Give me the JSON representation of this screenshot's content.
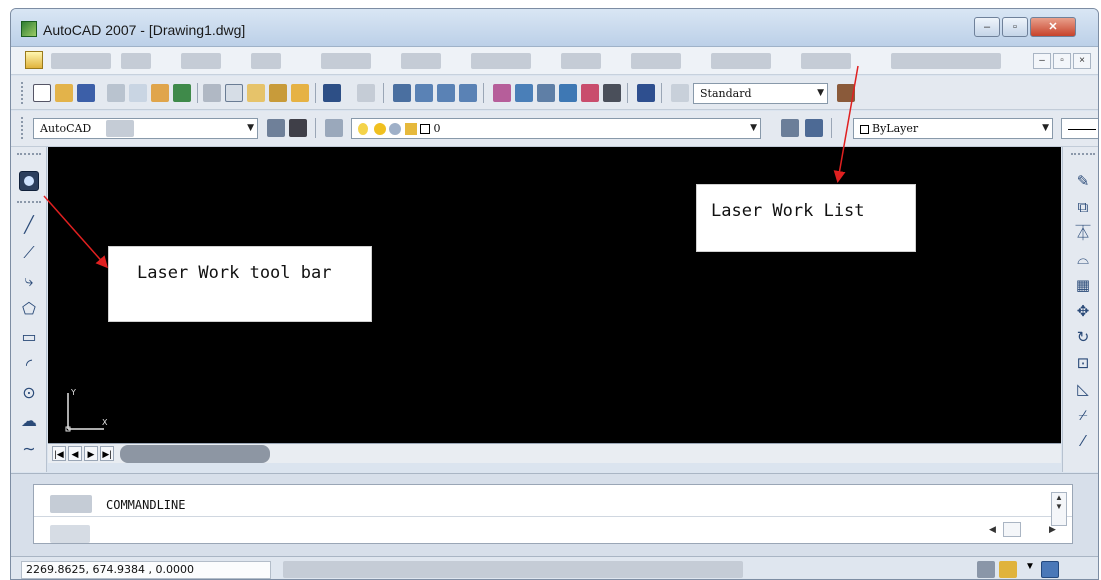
{
  "window": {
    "title": "AutoCAD 2007 - [Drawing1.dwg]",
    "controls": {
      "minimize": "–",
      "maximize": "▫",
      "close": "✕"
    },
    "mdi_controls": {
      "minimize": "–",
      "restore": "▫",
      "close": "×"
    }
  },
  "toolbar": {
    "workspace_combo": "AutoCAD",
    "layer_combo": "0",
    "textstyle_combo": "Standard",
    "color_combo": "ByLayer"
  },
  "callouts": {
    "toolbar": "Laser Work tool bar",
    "list": "Laser Work List"
  },
  "ucs": {
    "y_label": "Y",
    "x_label": "X"
  },
  "tabs": {
    "first": "|◀",
    "prev": "◀",
    "next": "▶",
    "last": "▶|"
  },
  "command": {
    "line1": "COMMANDLINE"
  },
  "status": {
    "coordinates": "2269.8625, 674.9384 , 0.0000"
  },
  "colors": {
    "canvas": "#000000",
    "callout_arrow": "#e02020",
    "accent": "#2a4a78"
  },
  "icons": {
    "left": [
      "laser-work-icon",
      "line-icon",
      "construction-line-icon",
      "polyline-icon",
      "polygon-icon",
      "rectangle-icon",
      "arc-icon",
      "circle-icon",
      "cloud-icon",
      "spline-icon"
    ],
    "right": [
      "erase-icon",
      "copy-icon",
      "mirror-icon",
      "offset-icon",
      "array-icon",
      "move-icon",
      "rotate-icon",
      "scale-icon",
      "stretch-icon",
      "trim-icon"
    ]
  }
}
